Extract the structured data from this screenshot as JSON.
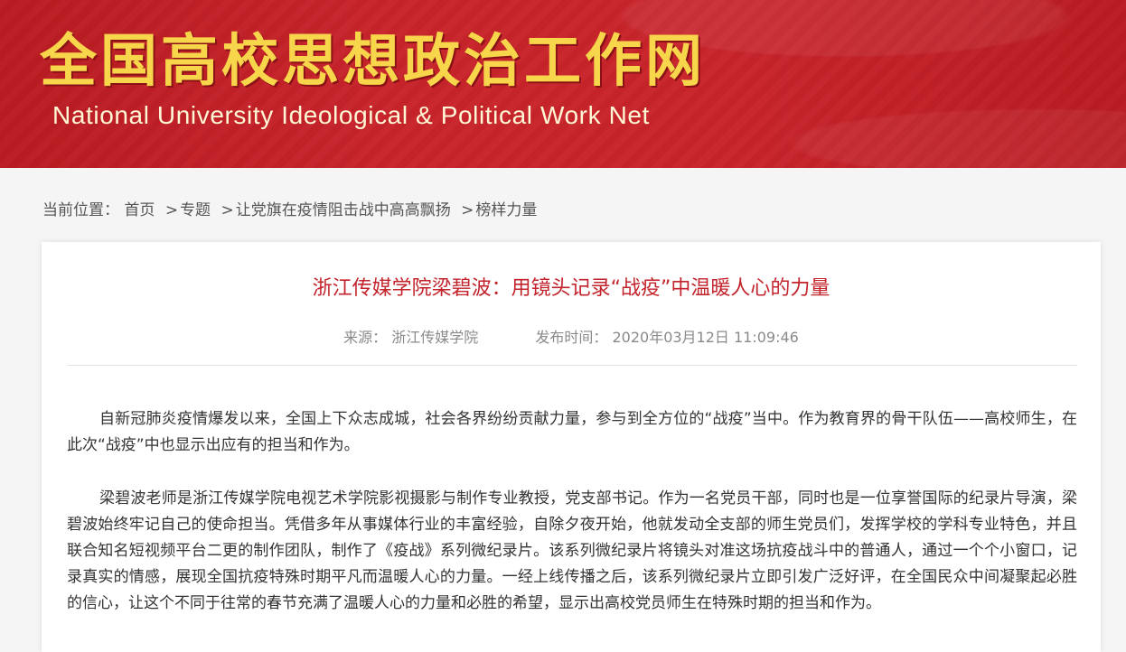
{
  "header": {
    "title_cn": "全国高校思想政治工作网",
    "title_en": "National University Ideological & Political Work Net"
  },
  "breadcrumb": {
    "label": "当前位置：",
    "items": [
      "首页",
      "专题",
      "让党旗在疫情阻击战中高高飘扬",
      "榜样力量"
    ],
    "separator": ">"
  },
  "article": {
    "title": "浙江传媒学院梁碧波：用镜头记录“战疫”中温暖人心的力量",
    "source_label": "来源：",
    "source_value": "浙江传媒学院",
    "publish_label": "发布时间：",
    "publish_value": "2020年03月12日 11:09:46",
    "paragraphs": [
      "自新冠肺炎疫情爆发以来，全国上下众志成城，社会各界纷纷贡献力量，参与到全方位的“战疫”当中。作为教育界的骨干队伍——高校师生，在此次“战疫”中也显示出应有的担当和作为。",
      "梁碧波老师是浙江传媒学院电视艺术学院影视摄影与制作专业教授，党支部书记。作为一名党员干部，同时也是一位享誉国际的纪录片导演，梁碧波始终牢记自己的使命担当。凭借多年从事媒体行业的丰富经验，自除夕夜开始，他就发动全支部的师生党员们，发挥学校的学科专业特色，并且联合知名短视频平台二更的制作团队，制作了《疫战》系列微纪录片。该系列微纪录片将镜头对准这场抗疫战斗中的普通人，通过一个个小窗口，记录真实的情感，展现全国抗疫特殊时期平凡而温暖人心的力量。一经上线传播之后，该系列微纪录片立即引发广泛好评，在全国民众中间凝聚起必胜的信心，让这个不同于往常的春节充满了温暖人心的力量和必胜的希望，显示出高校党员师生在特殊时期的担当和作为。"
    ]
  },
  "colors": {
    "banner_red": "#c8242b",
    "title_gold": "#f7d64b",
    "article_title_red": "#c3232b",
    "page_bg": "#f5f5f5"
  }
}
